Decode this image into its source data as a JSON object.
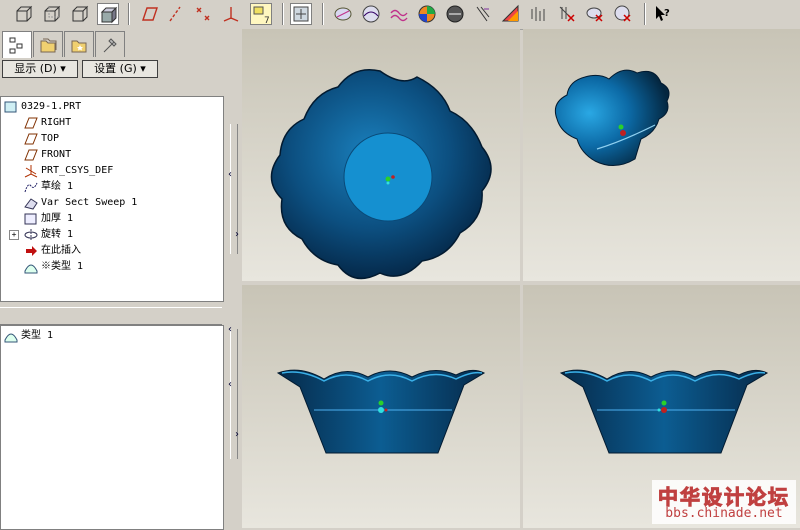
{
  "toolbar": {
    "buttons": [
      {
        "name": "view-wireframe-icon"
      },
      {
        "name": "view-hidden-line-icon"
      },
      {
        "name": "view-no-hidden-icon"
      },
      {
        "name": "view-shading-icon",
        "active": true
      },
      {
        "name": "datum-plane-display-icon"
      },
      {
        "name": "datum-axis-display-icon"
      },
      {
        "name": "datum-point-display-icon"
      },
      {
        "name": "csys-display-icon"
      },
      {
        "name": "annotation-display-icon"
      },
      {
        "name": "spin-center-icon"
      },
      {
        "name": "saved-views-icon"
      },
      {
        "name": "reflection-analysis-icon"
      },
      {
        "name": "curvature-analysis-icon"
      },
      {
        "name": "section-analysis-icon"
      },
      {
        "name": "draft-analysis-icon"
      },
      {
        "name": "slope-analysis-icon"
      },
      {
        "name": "offset-analysis-icon"
      },
      {
        "name": "distance-measure-icon"
      },
      {
        "name": "dihedral-analysis-icon"
      },
      {
        "name": "delete-analysis-icon"
      },
      {
        "name": "hide-analysis-icon"
      },
      {
        "name": "context-help-icon"
      }
    ]
  },
  "left_panel": {
    "tabs": [
      "model-tree",
      "folder-browser",
      "favorites",
      "connections"
    ],
    "show_label": "显示 (D)",
    "settings_label": "设置 (G)",
    "tree": [
      {
        "label": "0329-1.PRT",
        "icon": "part-icon",
        "indent": 0
      },
      {
        "label": "RIGHT",
        "icon": "datum-plane-icon",
        "indent": 1
      },
      {
        "label": "TOP",
        "icon": "datum-plane-icon",
        "indent": 1
      },
      {
        "label": "FRONT",
        "icon": "datum-plane-icon",
        "indent": 1
      },
      {
        "label": "PRT_CSYS_DEF",
        "icon": "csys-icon",
        "indent": 1
      },
      {
        "label": "草绘 1",
        "icon": "sketch-icon",
        "indent": 1
      },
      {
        "label": "Var Sect Sweep 1",
        "icon": "sweep-icon",
        "indent": 1
      },
      {
        "label": "加厚 1",
        "icon": "thicken-icon",
        "indent": 1
      },
      {
        "label": "旋转 1",
        "icon": "revolve-icon",
        "indent": 1,
        "expandable": true
      },
      {
        "label": "在此插入",
        "icon": "insert-here-icon",
        "indent": 1
      },
      {
        "label": "※类型 1",
        "icon": "surface-icon",
        "indent": 1
      }
    ],
    "selection": {
      "label": "类型 1",
      "icon": "surface-icon"
    }
  },
  "colors": {
    "bowl_dark": "#05294a",
    "bowl_mid": "#0c5d92",
    "bowl_light": "#1ea0d8",
    "viewport_top": "#c8c4b6",
    "viewport_bottom": "#e6e4dc"
  },
  "watermark": {
    "title": "中华设计论坛",
    "url": "bbs.chinade.net"
  }
}
